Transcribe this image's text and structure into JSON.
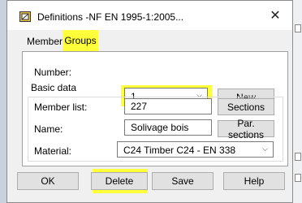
{
  "window": {
    "title": "Definitions -NF EN 1995-1:2005...",
    "close_glyph": "✕"
  },
  "tabs": [
    {
      "label": "Members"
    },
    {
      "label": "Groups",
      "selected": true
    }
  ],
  "form": {
    "number_label": "Number:",
    "number_value": "1",
    "new_label": "New",
    "basic_data_label": "Basic data",
    "member_list_label": "Member list:",
    "member_list_value": "227",
    "sections_label": "Sections",
    "name_label": "Name:",
    "name_value": "Solivage bois",
    "par_sections_label": "Par. sections",
    "material_label": "Material:",
    "material_value": "C24 Timber C24 - EN 338"
  },
  "footer": {
    "ok": "OK",
    "delete": "Delete",
    "save": "Save",
    "help": "Help"
  },
  "highlight_color": "#ffff3a",
  "icons": [
    "app-icon",
    "close-icon",
    "chevron-down-icon"
  ]
}
